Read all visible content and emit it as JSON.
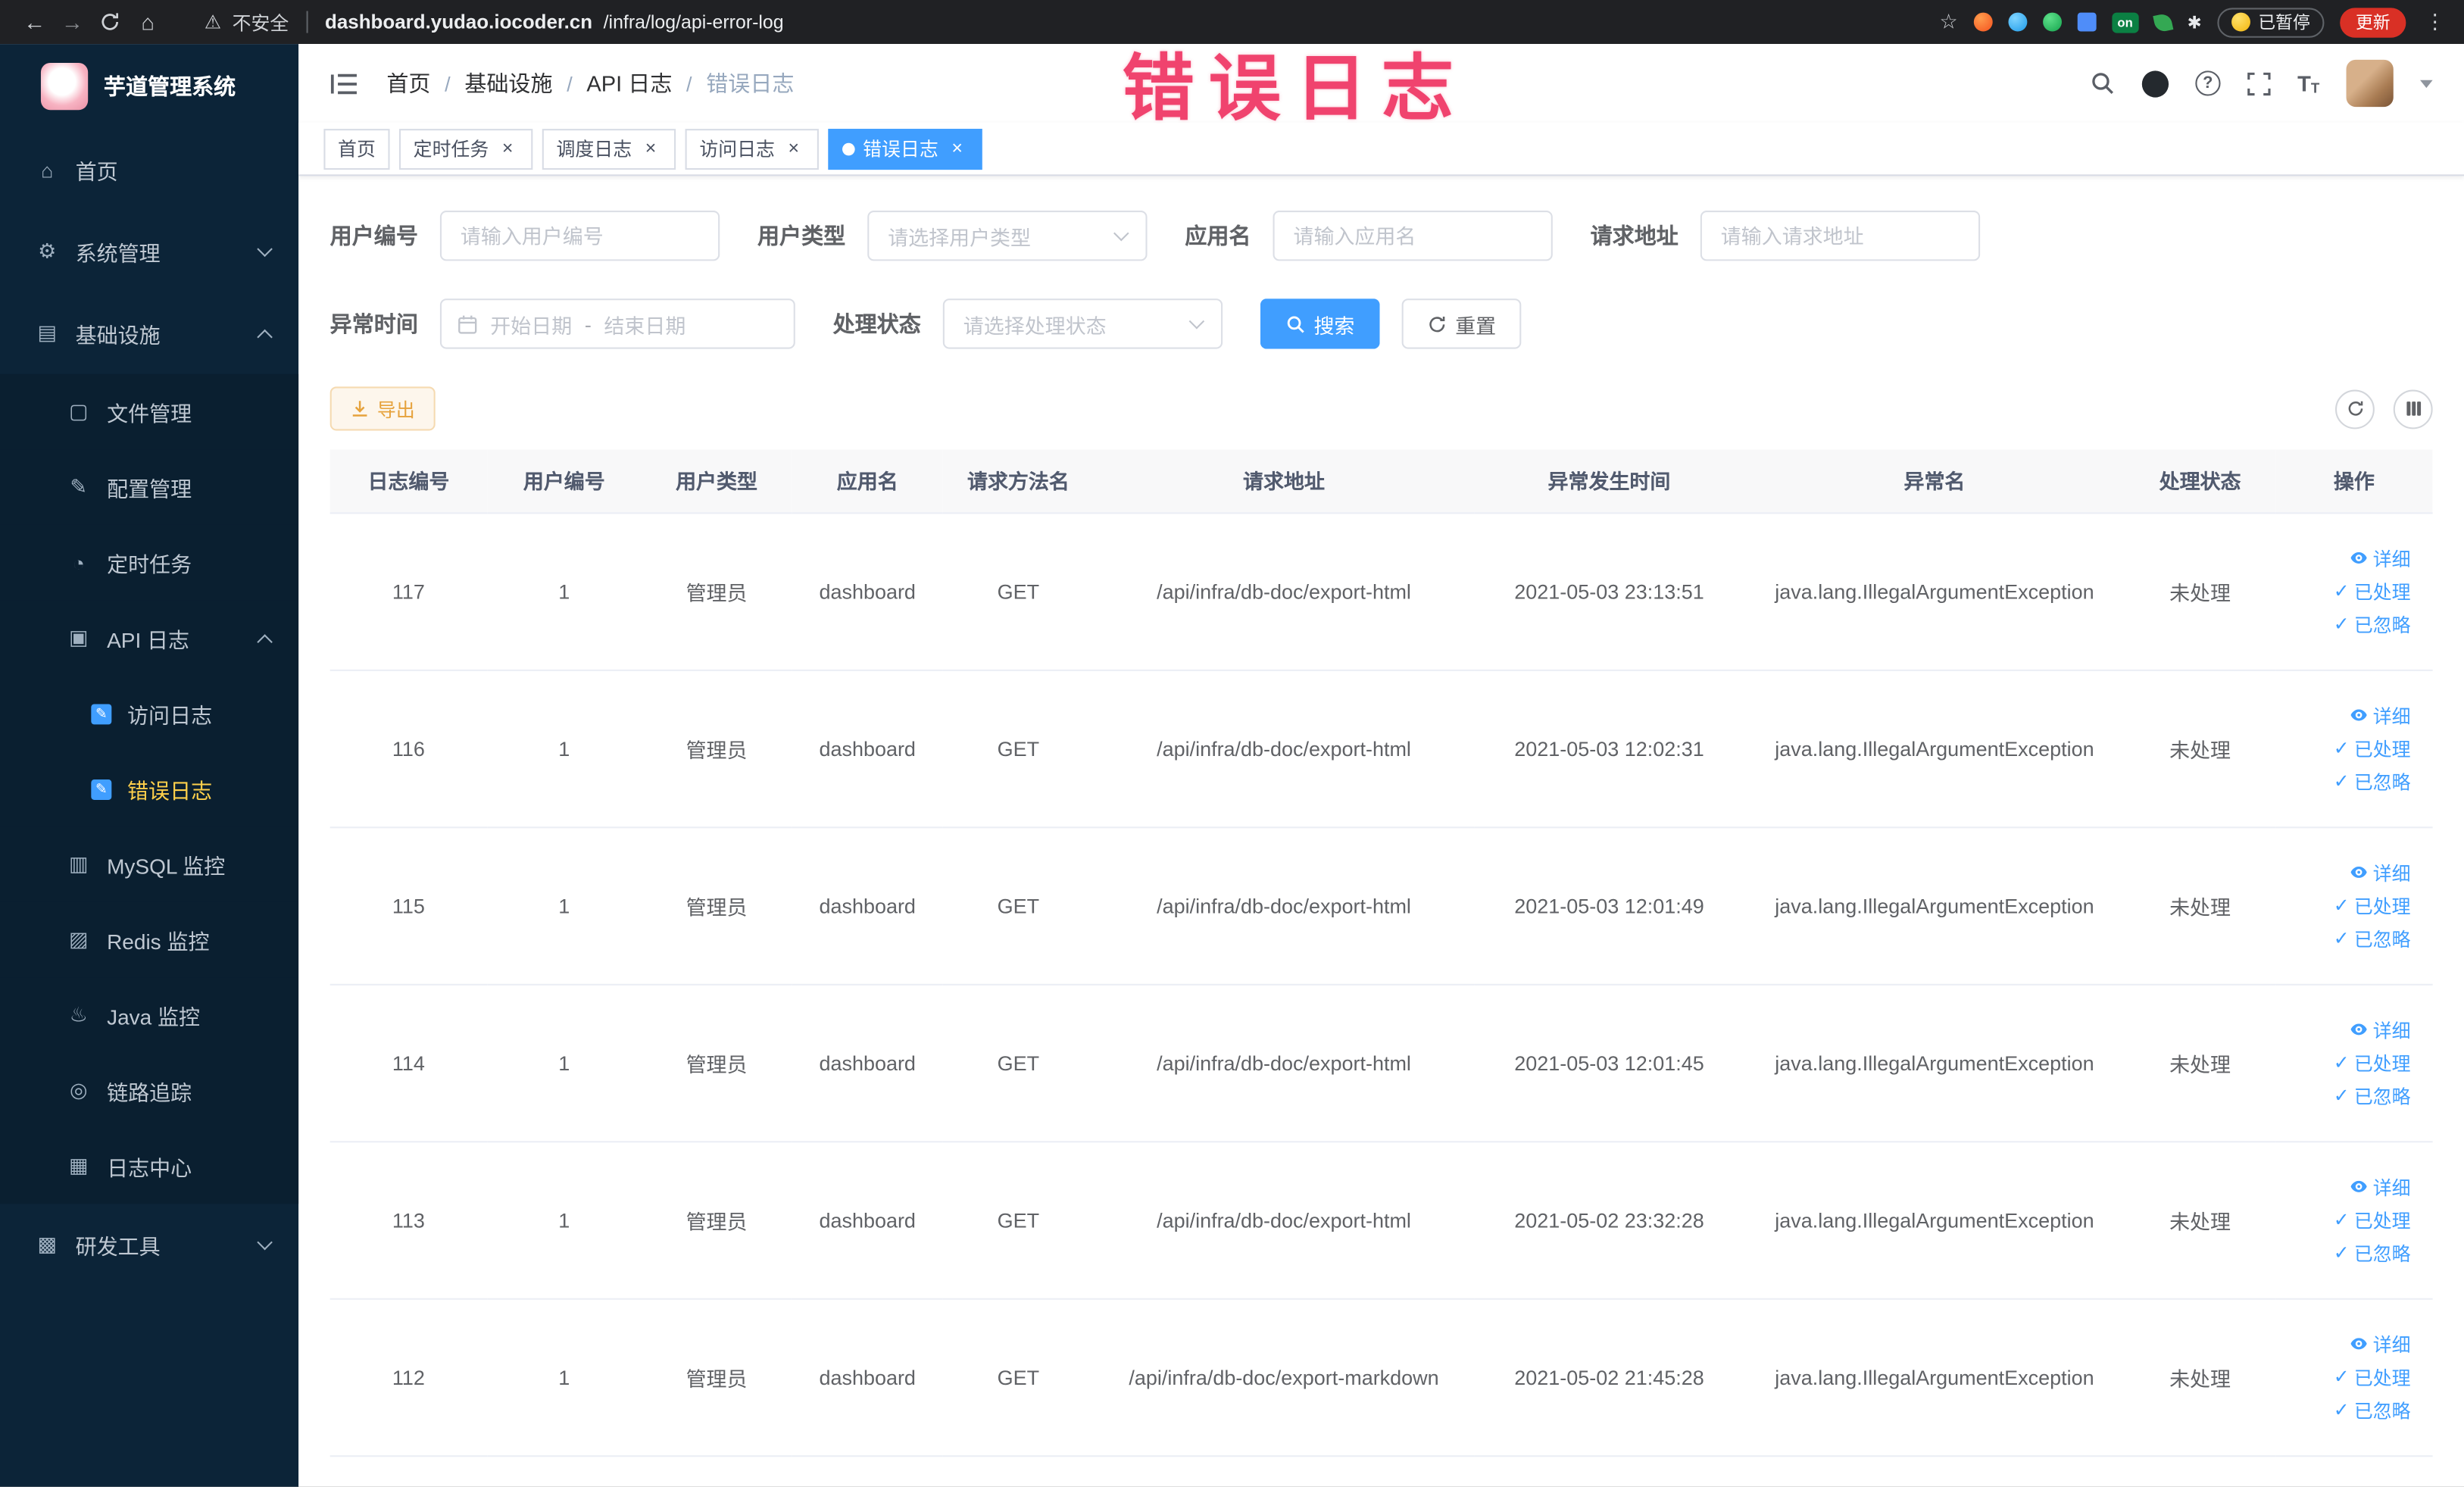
{
  "colors": {
    "accent": "#409EFF",
    "sidebar_bg": "#0c2438",
    "active_menu_text": "#ffd04b",
    "warning_button_text": "#e6a23c",
    "annotation": "#f0436e",
    "update_button": "#d93025"
  },
  "icons": {
    "back": "←",
    "forward": "→",
    "home": "⌂",
    "warning": "⚠",
    "star": "☆",
    "more": "⋮",
    "close": "×",
    "check": "✓",
    "question": "?",
    "font_size": "T",
    "paw": "✱",
    "on_badge": "on"
  },
  "annotation": {
    "text": "错误日志"
  },
  "browser": {
    "security_label": "不安全",
    "url_host": "dashboard.yudao.iocoder.cn",
    "url_path": "/infra/log/api-error-log",
    "paused_badge": "已暂停",
    "update_button": "更新"
  },
  "sidebar": {
    "brand": "芋道管理系统",
    "items": [
      {
        "label": "首页",
        "glyph": "⌂"
      },
      {
        "label": "系统管理",
        "glyph": "⚙"
      },
      {
        "label": "基础设施",
        "glyph": "▤"
      },
      {
        "label": "文件管理",
        "glyph": "▢"
      },
      {
        "label": "配置管理",
        "glyph": "✎"
      },
      {
        "label": "定时任务",
        "glyph": "◔"
      },
      {
        "label": "API 日志",
        "glyph": "▣"
      },
      {
        "label": "访问日志",
        "glyph": "✎"
      },
      {
        "label": "错误日志",
        "glyph": "✎"
      },
      {
        "label": "MySQL 监控",
        "glyph": "▥"
      },
      {
        "label": "Redis 监控",
        "glyph": "▨"
      },
      {
        "label": "Java 监控",
        "glyph": "♨"
      },
      {
        "label": "链路追踪",
        "glyph": "◎"
      },
      {
        "label": "日志中心",
        "glyph": "▦"
      },
      {
        "label": "研发工具",
        "glyph": "▩"
      }
    ]
  },
  "breadcrumb": [
    {
      "label": "首页"
    },
    {
      "label": "基础设施"
    },
    {
      "label": "API 日志"
    },
    {
      "label": "错误日志"
    }
  ],
  "ui": {
    "breadcrumb_separator": "/"
  },
  "tabs": [
    {
      "label": "首页"
    },
    {
      "label": "定时任务"
    },
    {
      "label": "调度日志"
    },
    {
      "label": "访问日志"
    },
    {
      "label": "错误日志"
    }
  ],
  "filters": {
    "user_id": {
      "label": "用户编号",
      "placeholder": "请输入用户编号"
    },
    "user_type": {
      "label": "用户类型",
      "placeholder": "请选择用户类型"
    },
    "app_name": {
      "label": "应用名",
      "placeholder": "请输入应用名"
    },
    "request_url": {
      "label": "请求地址",
      "placeholder": "请输入请求地址"
    },
    "exception_time": {
      "label": "异常时间",
      "start_placeholder": "开始日期",
      "separator": "-",
      "end_placeholder": "结束日期"
    },
    "process_status": {
      "label": "处理状态",
      "placeholder": "请选择处理状态"
    },
    "search_button": "搜索",
    "reset_button": "重置"
  },
  "toolbar": {
    "export_button": "导出"
  },
  "table": {
    "columns": [
      "日志编号",
      "用户编号",
      "用户类型",
      "应用名",
      "请求方法名",
      "请求地址",
      "异常发生时间",
      "异常名",
      "处理状态",
      "操作"
    ],
    "actions": {
      "detail": "详细",
      "processed": "已处理",
      "ignored": "已忽略"
    },
    "rows": [
      {
        "id": "117",
        "user_id": "1",
        "user_type": "管理员",
        "app_name": "dashboard",
        "method": "GET",
        "url": "/api/infra/db-doc/export-html",
        "time": "2021-05-03 23:13:51",
        "exception": "java.lang.IllegalArgumentException",
        "status": "未处理"
      },
      {
        "id": "116",
        "user_id": "1",
        "user_type": "管理员",
        "app_name": "dashboard",
        "method": "GET",
        "url": "/api/infra/db-doc/export-html",
        "time": "2021-05-03 12:02:31",
        "exception": "java.lang.IllegalArgumentException",
        "status": "未处理"
      },
      {
        "id": "115",
        "user_id": "1",
        "user_type": "管理员",
        "app_name": "dashboard",
        "method": "GET",
        "url": "/api/infra/db-doc/export-html",
        "time": "2021-05-03 12:01:49",
        "exception": "java.lang.IllegalArgumentException",
        "status": "未处理"
      },
      {
        "id": "114",
        "user_id": "1",
        "user_type": "管理员",
        "app_name": "dashboard",
        "method": "GET",
        "url": "/api/infra/db-doc/export-html",
        "time": "2021-05-03 12:01:45",
        "exception": "java.lang.IllegalArgumentException",
        "status": "未处理"
      },
      {
        "id": "113",
        "user_id": "1",
        "user_type": "管理员",
        "app_name": "dashboard",
        "method": "GET",
        "url": "/api/infra/db-doc/export-html",
        "time": "2021-05-02 23:32:28",
        "exception": "java.lang.IllegalArgumentException",
        "status": "未处理"
      },
      {
        "id": "112",
        "user_id": "1",
        "user_type": "管理员",
        "app_name": "dashboard",
        "method": "GET",
        "url": "/api/infra/db-doc/export-markdown",
        "time": "2021-05-02 21:45:28",
        "exception": "java.lang.IllegalArgumentException",
        "status": "未处理"
      }
    ]
  }
}
